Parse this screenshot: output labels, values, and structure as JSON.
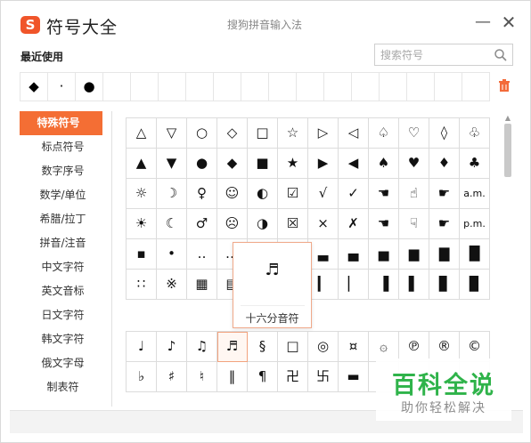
{
  "titlebar": {
    "logo_letter": "S",
    "title": "符号大全",
    "ime_name": "搜狗拼音输入法",
    "minimize_icon": "minimize-icon",
    "close_icon": "close-icon"
  },
  "recent": {
    "label": "最近使用",
    "symbols": [
      "◆",
      "·",
      "●",
      "",
      "",
      "",
      "",
      "",
      "",
      "",
      "",
      "",
      "",
      "",
      "",
      "",
      ""
    ]
  },
  "search": {
    "placeholder": "搜索符号",
    "icon": "search-icon"
  },
  "sidebar": {
    "active_color": "#f46e34",
    "items": [
      {
        "label": "特殊符号",
        "active": true
      },
      {
        "label": "标点符号",
        "active": false
      },
      {
        "label": "数字序号",
        "active": false
      },
      {
        "label": "数学/单位",
        "active": false
      },
      {
        "label": "希腊/拉丁",
        "active": false
      },
      {
        "label": "拼音/注音",
        "active": false
      },
      {
        "label": "中文字符",
        "active": false
      },
      {
        "label": "英文音标",
        "active": false
      },
      {
        "label": "日文字符",
        "active": false
      },
      {
        "label": "韩文字符",
        "active": false
      },
      {
        "label": "俄文字母",
        "active": false
      },
      {
        "label": "制表符",
        "active": false
      }
    ]
  },
  "grid_top": [
    [
      "△",
      "▽",
      "○",
      "◇",
      "□",
      "☆",
      "▷",
      "◁",
      "♤",
      "♡",
      "◊",
      "♧"
    ],
    [
      "▲",
      "▼",
      "●",
      "◆",
      "■",
      "★",
      "▶",
      "◀",
      "♠",
      "♥",
      "♦",
      "♣"
    ],
    [
      "☼",
      "☽",
      "♀",
      "☺",
      "◐",
      "☑",
      "√",
      "✓",
      "☚",
      "☝",
      "☛",
      "a.m."
    ],
    [
      "☀",
      "☾",
      "♂",
      "☹",
      "◑",
      "☒",
      "×",
      "✗",
      "☚",
      "☟",
      "☛",
      "p.m."
    ],
    [
      "▪",
      "•",
      "‥",
      "…",
      "▁",
      "▂",
      "▃",
      "▄",
      "▅",
      "▆",
      "▇",
      "█"
    ],
    [
      "∷",
      "※",
      "▦",
      "▤",
      "▌",
      "▍",
      "▎",
      "▏",
      "▐",
      "▌",
      "▊",
      "▉"
    ]
  ],
  "grid_bottom": [
    [
      "♩",
      "♪",
      "♫",
      "♬",
      "§",
      "□",
      "◎",
      "¤",
      "۞",
      "℗",
      "®",
      "©"
    ],
    [
      "♭",
      "♯",
      "♮",
      "‖",
      "¶",
      "卍",
      "卐",
      "▬",
      "",
      "",
      "",
      ""
    ]
  ],
  "tooltip": {
    "glyph": "♬",
    "name": "十六分音符"
  },
  "watermark": {
    "title": "百科全说",
    "subtitle": "助你轻松解决",
    "color": "#2fb34a"
  }
}
